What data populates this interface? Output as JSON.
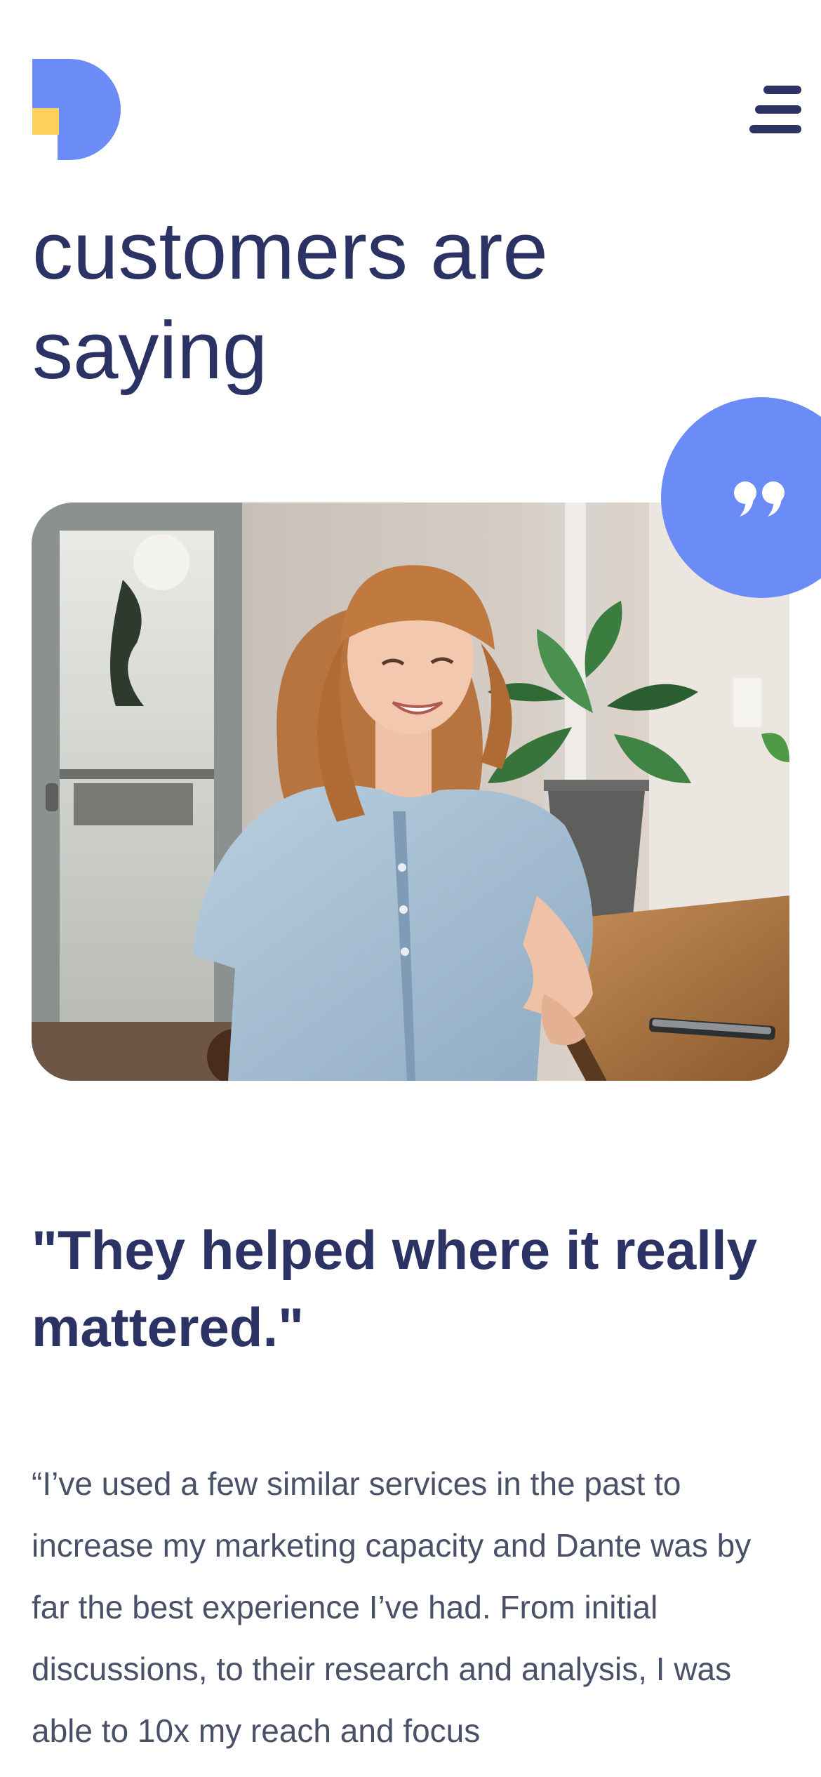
{
  "header": {
    "logo_icon": "dante-logo-icon",
    "menu_icon": "menu-icon"
  },
  "section": {
    "heading_line1": "customers are",
    "heading_line2": "saying"
  },
  "testimonial": {
    "quote_icon": "quote-icon",
    "title": "\"They helped where it really mattered.\"",
    "body": "“I’ve used a few similar services in the past to increase my marketing capacity and Dante was by far the best experience I’ve had. From initial discussions, to their research and analysis, I was able to 10x my reach and focus"
  },
  "colors": {
    "brand_blue": "#6b8bf6",
    "brand_yellow": "#fdd15b",
    "heading_navy": "#2b3264",
    "body_gray": "#4a5068"
  }
}
